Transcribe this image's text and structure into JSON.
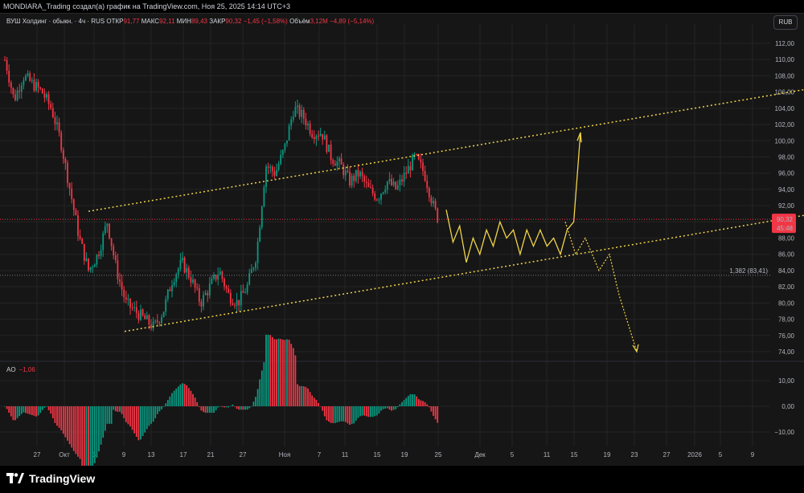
{
  "header": {
    "title": "MONDIARA_Trading создал(а) график на TradingView.com, Ноя 25, 2025 14:14 UTC+3"
  },
  "legend": {
    "symbol": "ВУШ Холдинг · обыкн. · 4ч · RUS",
    "open_label": "ОТКР",
    "open": "91,77",
    "high_label": "МАКС",
    "high": "92,11",
    "low_label": "МИН",
    "low": "89,43",
    "close_label": "ЗАКР",
    "close": "90,32",
    "change": "−1,45 (−1,58%)",
    "volume_label": "Объём",
    "volume": "3,12M",
    "volume_change": "−4,89 (−5,14%)"
  },
  "currency_button": "RUB",
  "price_tag": {
    "price": "90,32",
    "countdown": "45:48"
  },
  "measure_label": "1,382 (83,41)",
  "ao": {
    "name": "AO",
    "value": "−1,06"
  },
  "footer": {
    "brand": "TradingView"
  },
  "colors": {
    "up": "#089981",
    "down": "#f23645",
    "forecast": "#f0d44a",
    "background": "#161616",
    "grid": "#242424"
  },
  "chart_data": {
    "type": "candlestick",
    "title": "ВУШ Холдинг · обыкн. · 4ч · RUS",
    "y_ticks": [
      "112,00",
      "110,00",
      "108,00",
      "106,00",
      "104,00",
      "102,00",
      "100,00",
      "98,00",
      "96,00",
      "94,00",
      "92,00",
      "90,00",
      "88,00",
      "86,00",
      "84,00",
      "82,00",
      "80,00",
      "78,00",
      "76,00",
      "74,00"
    ],
    "ylim": [
      73,
      113
    ],
    "x_ticks": [
      "27",
      "Окт",
      "5",
      "9",
      "13",
      "17",
      "21",
      "27",
      "Ноя",
      "7",
      "11",
      "15",
      "19",
      "25",
      "Дек",
      "5",
      "11",
      "15",
      "19",
      "23",
      "27",
      "2026",
      "5",
      "9"
    ],
    "price_path_close": [
      [
        0,
        112
      ],
      [
        3,
        109
      ],
      [
        6,
        105
      ],
      [
        10,
        108
      ],
      [
        14,
        107
      ],
      [
        18,
        106
      ],
      [
        22,
        104
      ],
      [
        26,
        100
      ],
      [
        30,
        94
      ],
      [
        34,
        88
      ],
      [
        38,
        84
      ],
      [
        42,
        86
      ],
      [
        46,
        90
      ],
      [
        50,
        84
      ],
      [
        54,
        80
      ],
      [
        58,
        79
      ],
      [
        62,
        78
      ],
      [
        66,
        77
      ],
      [
        70,
        79
      ],
      [
        74,
        83
      ],
      [
        78,
        85
      ],
      [
        82,
        83
      ],
      [
        86,
        80
      ],
      [
        90,
        82
      ],
      [
        94,
        84
      ],
      [
        98,
        81
      ],
      [
        102,
        80
      ],
      [
        106,
        82
      ],
      [
        110,
        86
      ],
      [
        114,
        97
      ],
      [
        118,
        96
      ],
      [
        122,
        99
      ],
      [
        126,
        104
      ],
      [
        130,
        103
      ],
      [
        134,
        101
      ],
      [
        138,
        101
      ],
      [
        142,
        98
      ],
      [
        146,
        97
      ],
      [
        150,
        95
      ],
      [
        154,
        96
      ],
      [
        158,
        94
      ],
      [
        162,
        93
      ],
      [
        166,
        95
      ],
      [
        170,
        94
      ],
      [
        174,
        96
      ],
      [
        178,
        98
      ],
      [
        182,
        96
      ],
      [
        186,
        91.8
      ],
      [
        188,
        90.32
      ]
    ],
    "forecast_path_yellow": [
      [
        91.5
      ],
      [
        87.5
      ],
      [
        89.5
      ],
      [
        85
      ],
      [
        88
      ],
      [
        86
      ],
      [
        89
      ],
      [
        87
      ],
      [
        90
      ],
      [
        88
      ],
      [
        89
      ],
      [
        86
      ],
      [
        89
      ],
      [
        87
      ],
      [
        89
      ],
      [
        87
      ],
      [
        88
      ],
      [
        86
      ],
      [
        89
      ],
      [
        90
      ],
      [
        101
      ]
    ],
    "forecast_path_dotted": [
      [
        90
      ],
      [
        86
      ],
      [
        88
      ],
      [
        84
      ],
      [
        86
      ],
      [
        81
      ],
      [
        74
      ]
    ],
    "channel_upper": {
      "from": [
        110,
        91.3
      ],
      "to": [
        1000,
        106.3
      ]
    },
    "channel_lower": {
      "from": [
        155,
        76.5
      ],
      "to": [
        1000,
        90.8
      ]
    },
    "ao_ticks": [
      "10,00",
      "0,00",
      "−10,00"
    ],
    "ao_last": -1.06
  }
}
